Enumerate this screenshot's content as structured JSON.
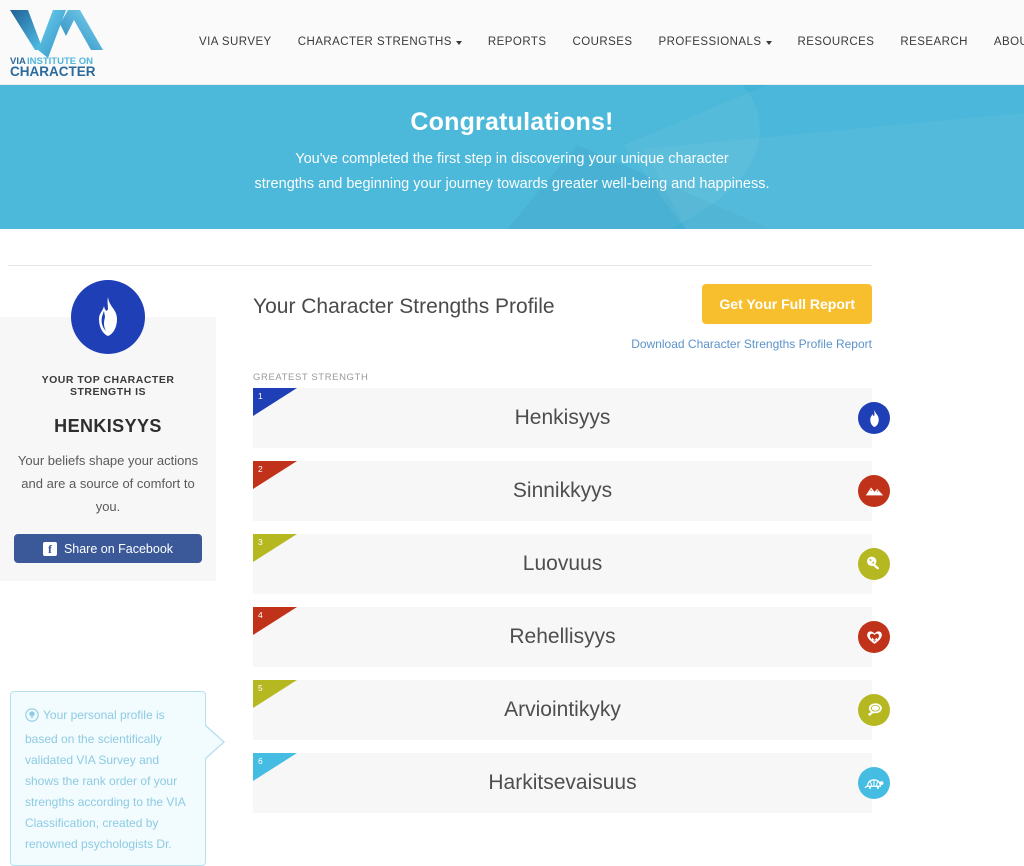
{
  "header": {
    "logo": {
      "name": "via-institute-on-character-logo",
      "line1": "VIA",
      "line2": "INSTITUTE ON",
      "line3": "CHARACTER"
    },
    "nav": [
      {
        "label": "VIA SURVEY",
        "has_dropdown": false
      },
      {
        "label": "CHARACTER STRENGTHS",
        "has_dropdown": true
      },
      {
        "label": "REPORTS",
        "has_dropdown": false
      },
      {
        "label": "COURSES",
        "has_dropdown": false
      },
      {
        "label": "PROFESSIONALS",
        "has_dropdown": true
      },
      {
        "label": "RESOURCES",
        "has_dropdown": false
      },
      {
        "label": "RESEARCH",
        "has_dropdown": false
      },
      {
        "label": "ABOUT",
        "has_dropdown": true
      }
    ]
  },
  "hero": {
    "title": "Congratulations!",
    "line1": "You've completed the first step in discovering your unique character",
    "line2": "strengths and beginning your journey towards greater well-being and happiness.",
    "bg_color": "#42b4d8"
  },
  "sidebar": {
    "badge_icon": "flame-icon",
    "eyebrow": "YOUR TOP CHARACTER STRENGTH IS",
    "strength_name": "HENKISYYS",
    "description": "Your beliefs shape your actions and are a source of comfort to you.",
    "share_button": "Share on Facebook",
    "share_color": "#3b5998",
    "callout": {
      "icon": "lightbulb-icon",
      "text": "Your personal profile is based on the scientifically validated VIA Survey and shows the rank order of your strengths according to the VIA Classification, created by renowned psychologists Dr.",
      "color": "#8dcbe2"
    }
  },
  "main": {
    "profile_title": "Your Character Strengths Profile",
    "cta_label": "Get Your Full Report",
    "cta_color": "#f7bf2e",
    "download_link": "Download Character Strengths Profile Report",
    "greatest_label": "GREATEST STRENGTH",
    "strengths": [
      {
        "rank": "1",
        "name": "Henkisyys",
        "color": "#1e3fb5",
        "icon": "flame-icon"
      },
      {
        "rank": "2",
        "name": "Sinnikkyys",
        "color": "#c0331a",
        "icon": "mountains-icon"
      },
      {
        "rank": "3",
        "name": "Luovuus",
        "color": "#b5b821",
        "icon": "paintbrush-icon"
      },
      {
        "rank": "4",
        "name": "Rehellisyys",
        "color": "#c0331a",
        "icon": "heart-icon"
      },
      {
        "rank": "5",
        "name": "Arviointikyky",
        "color": "#b5b821",
        "icon": "speech-bubble-icon"
      },
      {
        "rank": "6",
        "name": "Harkitsevaisuus",
        "color": "#45bde2",
        "icon": "turtle-icon"
      }
    ]
  }
}
